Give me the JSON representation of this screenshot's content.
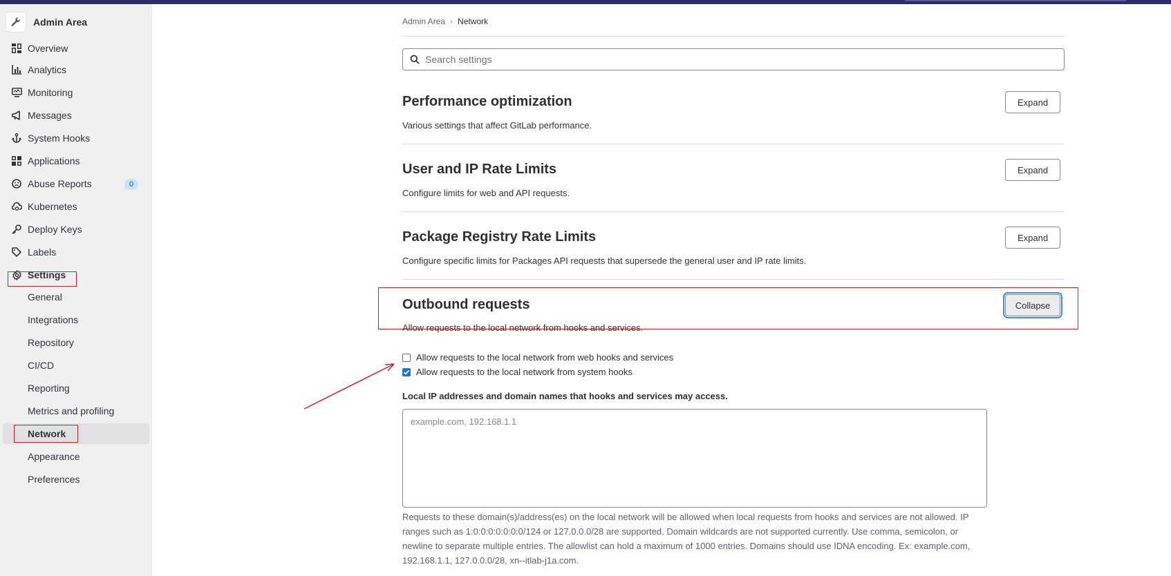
{
  "sidebar": {
    "title": "Admin Area",
    "items": [
      {
        "label": "Overview",
        "icon": "overview-icon"
      },
      {
        "label": "Analytics",
        "icon": "analytics-icon"
      },
      {
        "label": "Monitoring",
        "icon": "monitor-icon"
      },
      {
        "label": "Messages",
        "icon": "megaphone-icon"
      },
      {
        "label": "System Hooks",
        "icon": "hook-icon"
      },
      {
        "label": "Applications",
        "icon": "applications-icon"
      },
      {
        "label": "Abuse Reports",
        "icon": "abuse-icon",
        "badge": "0"
      },
      {
        "label": "Kubernetes",
        "icon": "cloud-gear-icon"
      },
      {
        "label": "Deploy Keys",
        "icon": "key-icon"
      },
      {
        "label": "Labels",
        "icon": "label-icon"
      },
      {
        "label": "Settings",
        "icon": "settings-icon"
      }
    ],
    "settings_sub": [
      {
        "label": "General"
      },
      {
        "label": "Integrations"
      },
      {
        "label": "Repository"
      },
      {
        "label": "CI/CD"
      },
      {
        "label": "Reporting"
      },
      {
        "label": "Metrics and profiling"
      },
      {
        "label": "Network",
        "active": true
      },
      {
        "label": "Appearance"
      },
      {
        "label": "Preferences"
      }
    ]
  },
  "breadcrumb": {
    "root": "Admin Area",
    "current": "Network"
  },
  "search": {
    "placeholder": "Search settings"
  },
  "sections": [
    {
      "title": "Performance optimization",
      "desc": "Various settings that affect GitLab performance.",
      "button": "Expand"
    },
    {
      "title": "User and IP Rate Limits",
      "desc": "Configure limits for web and API requests.",
      "button": "Expand"
    },
    {
      "title": "Package Registry Rate Limits",
      "desc": "Configure specific limits for Packages API requests that supersede the general user and IP rate limits.",
      "button": "Expand"
    },
    {
      "title": "Outbound requests",
      "desc": "Allow requests to the local network from hooks and services.",
      "button": "Collapse"
    }
  ],
  "outbound": {
    "checkbox_web_hooks": {
      "label": "Allow requests to the local network from web hooks and services",
      "checked": false
    },
    "checkbox_system_hooks": {
      "label": "Allow requests to the local network from system hooks",
      "checked": true
    },
    "allowlist_label": "Local IP addresses and domain names that hooks and services may access.",
    "allowlist_placeholder": "example.com, 192.168.1.1",
    "allowlist_help": "Requests to these domain(s)/address(es) on the local network will be allowed when local requests from hooks and services are not allowed. IP ranges such as 1:0:0:0:0:0:0:0/124 or 127.0.0.0/28 are supported. Domain wildcards are not supported currently. Use comma, semicolon, or newline to separate multiple entries. The allowlist can hold a maximum of 1000 entries. Domains should use IDNA encoding. Ex: example.com, 192.168.1.1, 127.0.0.0/28, xn--itlab-j1a.com."
  },
  "colors": {
    "annotation": "#d0202a",
    "primary": "#1f75cb",
    "topbar": "#2f2a6b"
  }
}
